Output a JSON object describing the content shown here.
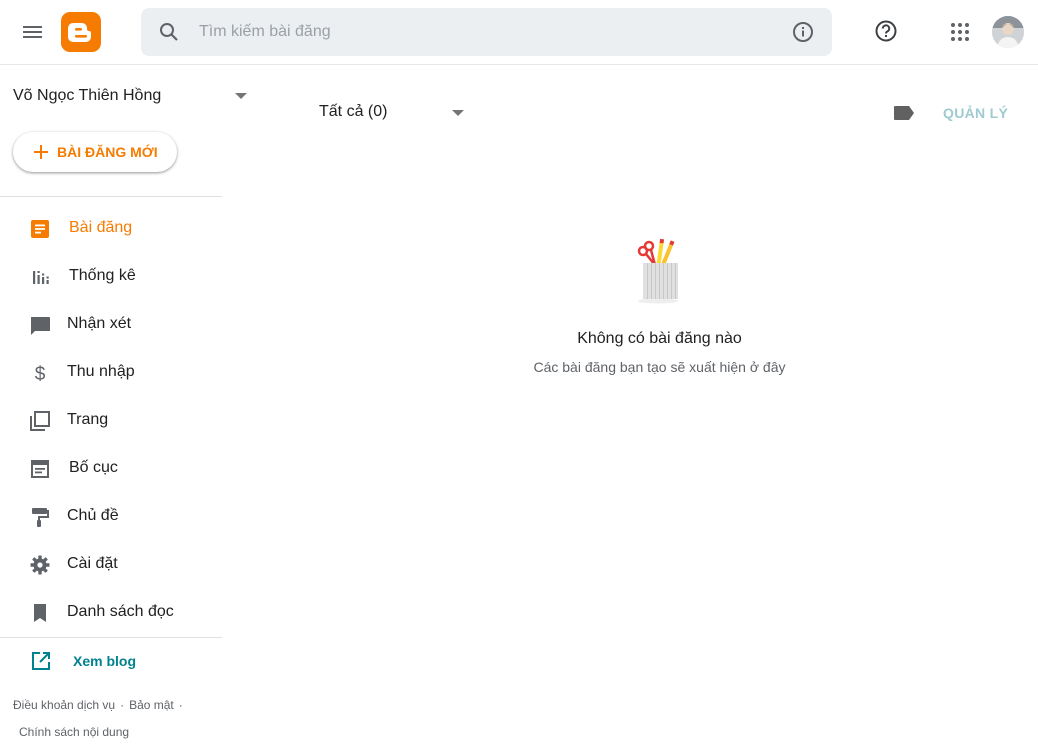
{
  "header": {
    "search_placeholder": "Tìm kiếm bài đăng",
    "accent_color": "#f57c00"
  },
  "sidebar": {
    "blog_name": "Võ Ngọc Thiên Hồng",
    "new_post_label": "BÀI ĐĂNG MỚI",
    "items": [
      {
        "label": "Bài đăng",
        "icon": "posts-icon",
        "active": true
      },
      {
        "label": "Thống kê",
        "icon": "stats-icon"
      },
      {
        "label": "Nhận xét",
        "icon": "comments-icon"
      },
      {
        "label": "Thu nhập",
        "icon": "dollar-icon"
      },
      {
        "label": "Trang",
        "icon": "pages-icon"
      },
      {
        "label": "Bố cục",
        "icon": "layout-icon"
      },
      {
        "label": "Chủ đề",
        "icon": "paint-roller-icon"
      },
      {
        "label": "Cài đặt",
        "icon": "gear-icon"
      },
      {
        "label": "Danh sách đọc",
        "icon": "bookmark-icon"
      }
    ],
    "view_blog_label": "Xem blog",
    "footer": {
      "terms": "Điều khoản dịch vụ",
      "privacy": "Bảo mật",
      "content_policy": "Chính sách nội dung",
      "separator": "·"
    }
  },
  "main": {
    "filter_label": "Tất cả (0)",
    "manage_label": "QUẢN LÝ",
    "empty_title": "Không có bài đăng nào",
    "empty_subtitle": "Các bài đăng bạn tạo sẽ xuất hiện ở đây"
  }
}
